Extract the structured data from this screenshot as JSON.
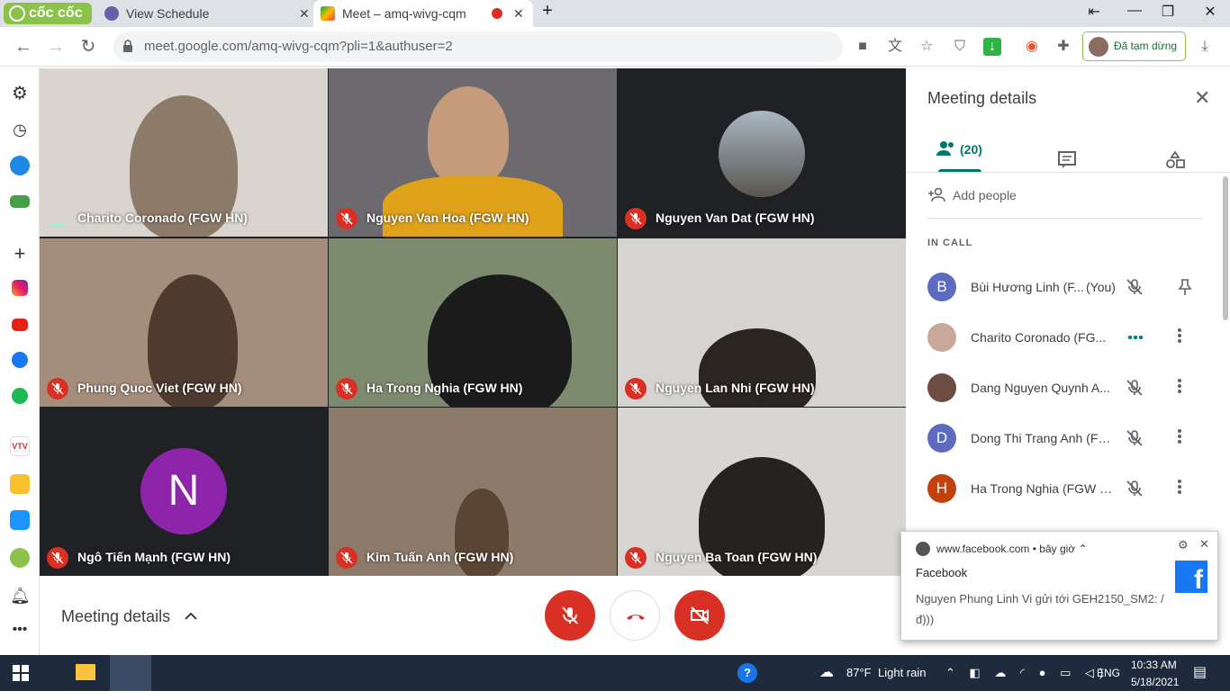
{
  "browser": {
    "brand": "cốc cốc",
    "tabs": [
      {
        "title": "View Schedule",
        "active": false
      },
      {
        "title": "Meet – amq-wivg-cqm",
        "active": true
      }
    ],
    "url": "meet.google.com/amq-wivg-cqm?pli=1&authuser=2",
    "profile_status": "Đã tạm dừng"
  },
  "participants_grid": [
    {
      "name": "Charito Coronado (FGW HN)",
      "muted": false,
      "speaking": true
    },
    {
      "name": "Nguyen Van Hoa (FGW HN)",
      "muted": true
    },
    {
      "name": "Nguyen Van Dat (FGW HN)",
      "muted": true
    },
    {
      "name": "Phung Quoc Viet (FGW HN)",
      "muted": true
    },
    {
      "name": "Ha Trong Nghia (FGW HN)",
      "muted": true
    },
    {
      "name": "Nguyen Lan Nhi (FGW HN)",
      "muted": true
    },
    {
      "name": "Ngô Tiến Mạnh (FGW HN)",
      "muted": true,
      "initial": "N"
    },
    {
      "name": "Kim Tuấn Anh (FGW HN)",
      "muted": true
    },
    {
      "name": "Nguyen Ba Toan (FGW HN)",
      "muted": true
    }
  ],
  "panel": {
    "title": "Meeting details",
    "people_count": "(20)",
    "add_people": "Add people",
    "in_call": "IN CALL",
    "people": [
      {
        "initial": "B",
        "name": "Bùi Hương Linh (F...",
        "you": "(You)",
        "color": "#5c6bc0"
      },
      {
        "initial": "",
        "name": "Charito Coronado (FG...",
        "color": "#c9a89a"
      },
      {
        "initial": "",
        "name": "Dang Nguyen Quynh A...",
        "color": "#6d4c41"
      },
      {
        "initial": "D",
        "name": "Dong Thi Trang Anh (FG...",
        "color": "#5c6bc0"
      },
      {
        "initial": "H",
        "name": "Ha Trong Nghia (FGW H...",
        "color": "#c2410c"
      }
    ]
  },
  "bottom": {
    "meeting_details": "Meeting details"
  },
  "notification": {
    "source": "www.facebook.com",
    "time": "bây giờ",
    "title": "Facebook",
    "body": "Nguyen Phung Linh Vi gửi tới GEH2150_SM2: / đ)))"
  },
  "taskbar": {
    "temperature": "87°F",
    "weather": "Light rain",
    "language": "ENG",
    "time": "10:33 AM",
    "date": "5/18/2021"
  },
  "colors": {
    "accent": "#00796b",
    "danger": "#d93025",
    "brand": "#8bc34a"
  }
}
